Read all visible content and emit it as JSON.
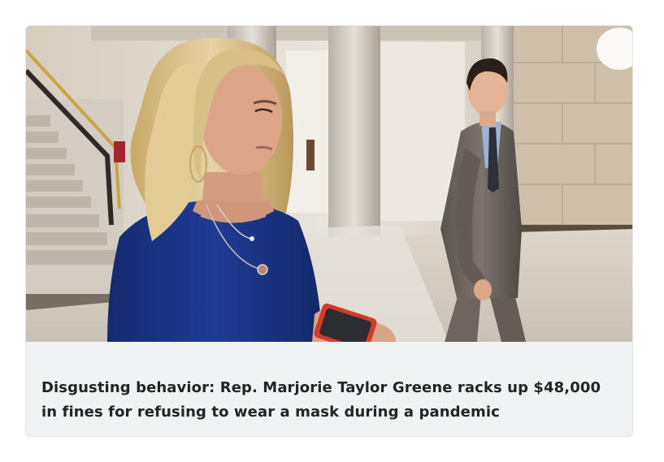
{
  "article_card": {
    "headline": "Disgusting behavior: Rep. Marjorie Taylor Greene racks up $48,000 in fines for refusing to wear a mask during a pandemic",
    "image_icon": "news-photo",
    "colors": {
      "caption_background": "#f1f2f4",
      "headline_text": "#222428",
      "card_border": "#e3e4e6"
    }
  }
}
